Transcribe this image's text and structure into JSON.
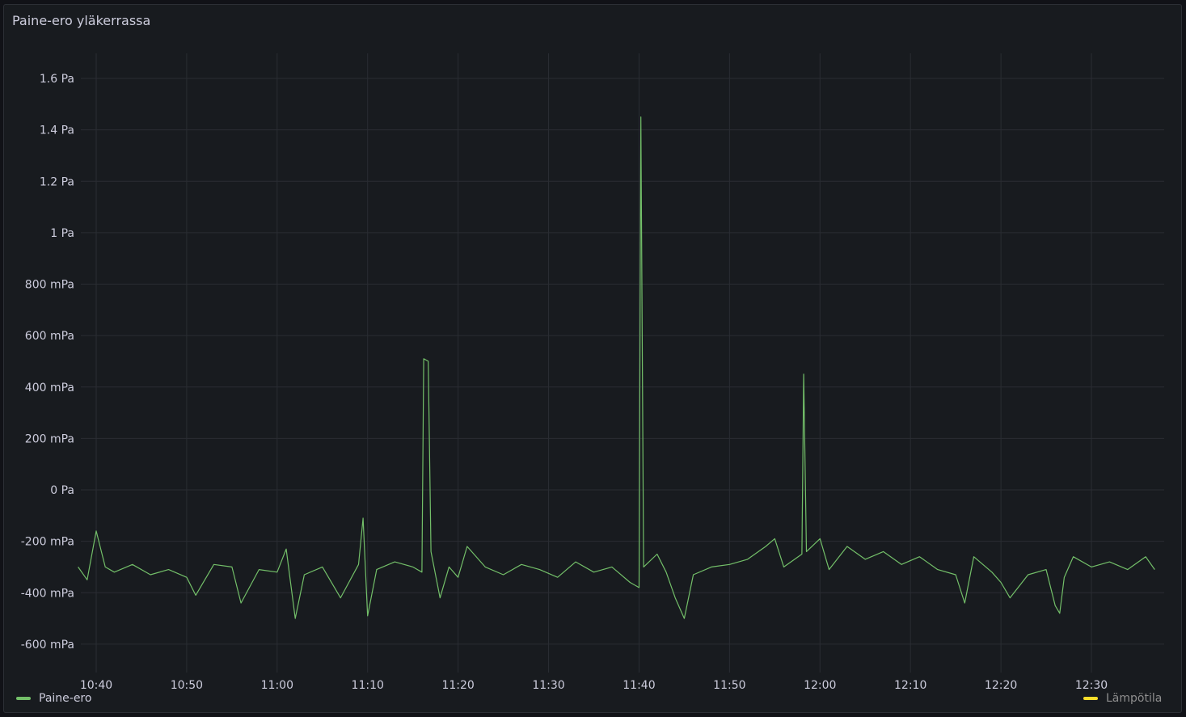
{
  "panel": {
    "title": "Paine-ero yläkerrassa"
  },
  "legend": [
    {
      "name": "Paine-ero",
      "color": "#73bf69"
    },
    {
      "name": "Lämpötila",
      "color": "#fade2a"
    }
  ],
  "chart_data": {
    "type": "line",
    "title": "Paine-ero yläkerrassa",
    "y_ticks": [
      {
        "value": 1.6,
        "label": "1.6 Pa"
      },
      {
        "value": 1.4,
        "label": "1.4 Pa"
      },
      {
        "value": 1.2,
        "label": "1.2 Pa"
      },
      {
        "value": 1.0,
        "label": "1 Pa"
      },
      {
        "value": 0.8,
        "label": "800 mPa"
      },
      {
        "value": 0.6,
        "label": "600 mPa"
      },
      {
        "value": 0.4,
        "label": "400 mPa"
      },
      {
        "value": 0.2,
        "label": "200 mPa"
      },
      {
        "value": 0.0,
        "label": "0 Pa"
      },
      {
        "value": -0.2,
        "label": "-200 mPa"
      },
      {
        "value": -0.4,
        "label": "-400 mPa"
      },
      {
        "value": -0.6,
        "label": "-600 mPa"
      }
    ],
    "x_ticks": [
      "10:40",
      "10:50",
      "11:00",
      "11:10",
      "11:20",
      "11:30",
      "11:40",
      "11:50",
      "12:00",
      "12:10",
      "12:20",
      "12:30"
    ],
    "ylim": [
      -0.7,
      1.7
    ],
    "x_range": [
      "10:38",
      "12:38"
    ],
    "grid": true,
    "legend_position": "bottom",
    "series": [
      {
        "name": "Paine-ero",
        "color": "#73bf69",
        "points": [
          [
            "10:38",
            -0.3
          ],
          [
            "10:39",
            -0.35
          ],
          [
            "10:40",
            -0.16
          ],
          [
            "10:41",
            -0.3
          ],
          [
            "10:42",
            -0.32
          ],
          [
            "10:44",
            -0.29
          ],
          [
            "10:46",
            -0.33
          ],
          [
            "10:48",
            -0.31
          ],
          [
            "10:50",
            -0.34
          ],
          [
            "10:51",
            -0.41
          ],
          [
            "10:53",
            -0.29
          ],
          [
            "10:55",
            -0.3
          ],
          [
            "10:56",
            -0.44
          ],
          [
            "10:58",
            -0.31
          ],
          [
            "11:00",
            -0.32
          ],
          [
            "11:01",
            -0.23
          ],
          [
            "11:02",
            -0.5
          ],
          [
            "11:03",
            -0.33
          ],
          [
            "11:05",
            -0.3
          ],
          [
            "11:07",
            -0.42
          ],
          [
            "11:09",
            -0.29
          ],
          [
            "11:09.5",
            -0.11
          ],
          [
            "11:10",
            -0.49
          ],
          [
            "11:11",
            -0.31
          ],
          [
            "11:13",
            -0.28
          ],
          [
            "11:15",
            -0.3
          ],
          [
            "11:16",
            -0.32
          ],
          [
            "11:16.2",
            0.51
          ],
          [
            "11:16.7",
            0.5
          ],
          [
            "11:17",
            -0.24
          ],
          [
            "11:18",
            -0.42
          ],
          [
            "11:19",
            -0.3
          ],
          [
            "11:20",
            -0.34
          ],
          [
            "11:21",
            -0.22
          ],
          [
            "11:23",
            -0.3
          ],
          [
            "11:25",
            -0.33
          ],
          [
            "11:27",
            -0.29
          ],
          [
            "11:29",
            -0.31
          ],
          [
            "11:31",
            -0.34
          ],
          [
            "11:33",
            -0.28
          ],
          [
            "11:35",
            -0.32
          ],
          [
            "11:37",
            -0.3
          ],
          [
            "11:39",
            -0.36
          ],
          [
            "11:40",
            -0.38
          ],
          [
            "11:40.2",
            1.45
          ],
          [
            "11:40.5",
            -0.3
          ],
          [
            "11:42",
            -0.25
          ],
          [
            "11:43",
            -0.32
          ],
          [
            "11:44",
            -0.42
          ],
          [
            "11:45",
            -0.5
          ],
          [
            "11:46",
            -0.33
          ],
          [
            "11:48",
            -0.3
          ],
          [
            "11:50",
            -0.29
          ],
          [
            "11:52",
            -0.27
          ],
          [
            "11:54",
            -0.22
          ],
          [
            "11:55",
            -0.19
          ],
          [
            "11:56",
            -0.3
          ],
          [
            "11:58",
            -0.25
          ],
          [
            "11:58.2",
            0.45
          ],
          [
            "11:58.5",
            -0.24
          ],
          [
            "12:00",
            -0.19
          ],
          [
            "12:01",
            -0.31
          ],
          [
            "12:03",
            -0.22
          ],
          [
            "12:05",
            -0.27
          ],
          [
            "12:07",
            -0.24
          ],
          [
            "12:09",
            -0.29
          ],
          [
            "12:11",
            -0.26
          ],
          [
            "12:13",
            -0.31
          ],
          [
            "12:15",
            -0.33
          ],
          [
            "12:16",
            -0.44
          ],
          [
            "12:17",
            -0.26
          ],
          [
            "12:19",
            -0.32
          ],
          [
            "12:20",
            -0.36
          ],
          [
            "12:21",
            -0.42
          ],
          [
            "12:23",
            -0.33
          ],
          [
            "12:25",
            -0.31
          ],
          [
            "12:26",
            -0.45
          ],
          [
            "12:26.5",
            -0.48
          ],
          [
            "12:27",
            -0.34
          ],
          [
            "12:28",
            -0.26
          ],
          [
            "12:30",
            -0.3
          ],
          [
            "12:32",
            -0.28
          ],
          [
            "12:34",
            -0.31
          ],
          [
            "12:36",
            -0.26
          ],
          [
            "12:37",
            -0.31
          ]
        ]
      },
      {
        "name": "Lämpötila",
        "color": "#fade2a",
        "points": []
      }
    ]
  }
}
